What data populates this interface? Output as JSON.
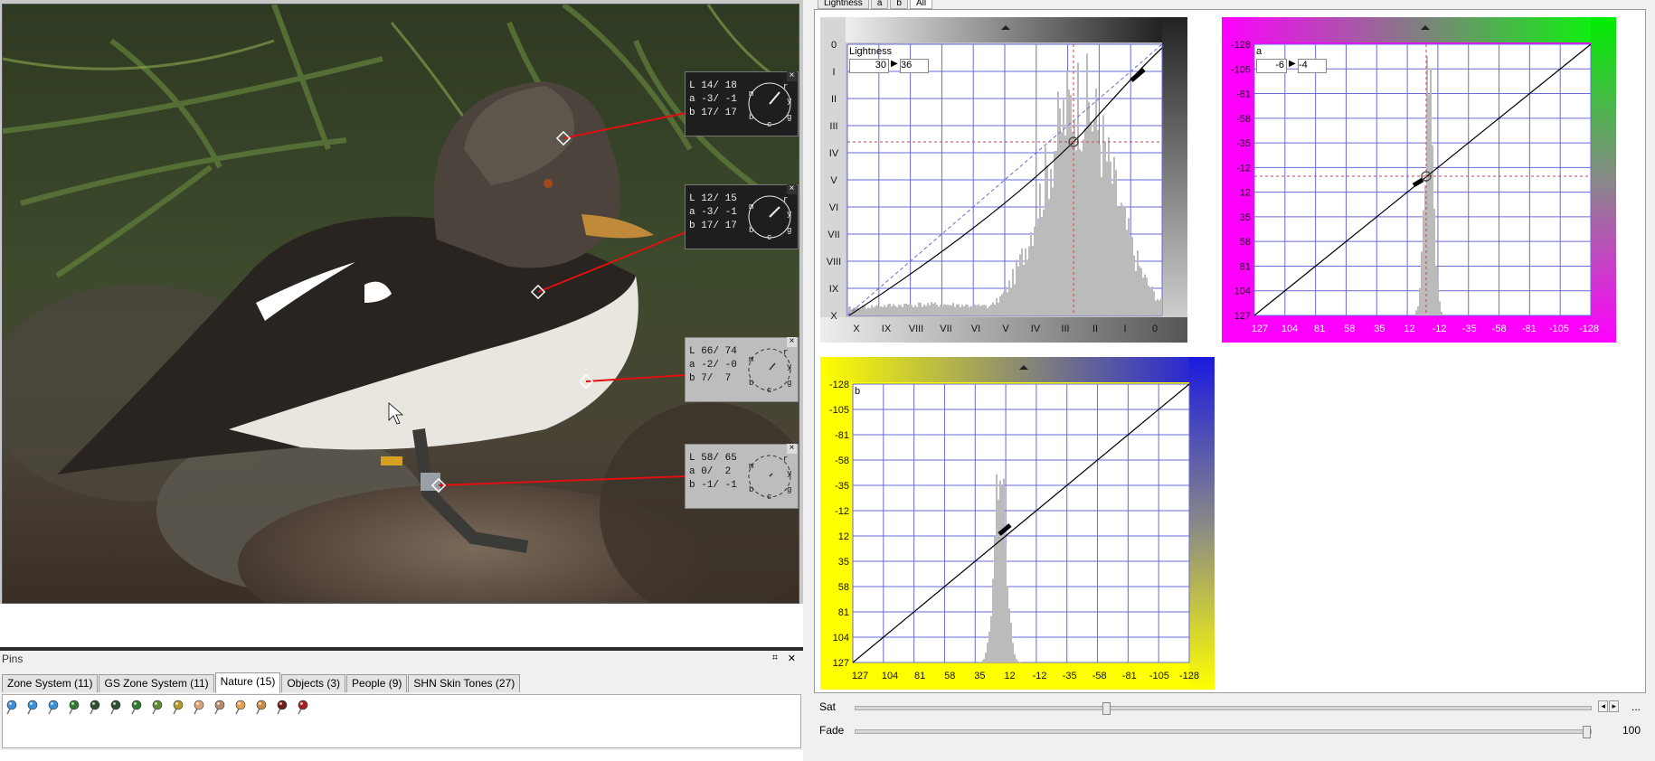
{
  "curves_tabs": [
    "Lightness",
    "a",
    "b",
    "All"
  ],
  "pins_dock": {
    "title": "Pins",
    "pin_button": "⌗",
    "close_button": "✕",
    "tabs": [
      {
        "label": "Zone System (11)",
        "active": false
      },
      {
        "label": "GS Zone System (11)",
        "active": false
      },
      {
        "label": "Nature (15)",
        "active": true
      },
      {
        "label": "Objects (3)",
        "active": false
      },
      {
        "label": "People (9)",
        "active": false
      },
      {
        "label": "SHN Skin Tones (27)",
        "active": false
      }
    ],
    "pin_colors": [
      "#3b8fd6",
      "#3b8fd6",
      "#3b8fd6",
      "#2f7a2f",
      "#2d4f2d",
      "#2d4f2d",
      "#2f7a2f",
      "#5c8b33",
      "#b39a2a",
      "#d8a27a",
      "#b58a6a",
      "#e0a050",
      "#c88a40",
      "#6b1f1f",
      "#a81f1f"
    ]
  },
  "pin_readouts": [
    {
      "L": "14/ 18",
      "a": "-3/ -1",
      "b": "17/ 17",
      "theme": "dark"
    },
    {
      "L": "12/ 15",
      "a": "-3/ -1",
      "b": "17/ 17",
      "theme": "dark"
    },
    {
      "L": "66/ 74",
      "a": "-2/ -0",
      "b": "7/  7",
      "theme": "light"
    },
    {
      "L": "58/ 65",
      "a": "0/  2",
      "b": "-1/ -1",
      "theme": "light"
    }
  ],
  "dial_letters": {
    "m": "m",
    "r": "r",
    "y": "y",
    "g": "g",
    "c": "c",
    "b": "b"
  },
  "curves": {
    "lightness": {
      "name": "Lightness",
      "in_value": "30",
      "out_value": "36",
      "y_ticks": [
        "0",
        "I",
        "II",
        "III",
        "IV",
        "V",
        "VI",
        "VII",
        "VIII",
        "IX",
        "X"
      ],
      "x_ticks": [
        "X",
        "IX",
        "VIII",
        "VII",
        "VI",
        "V",
        "IV",
        "III",
        "II",
        "I",
        "0"
      ]
    },
    "a": {
      "name": "a",
      "in_value": "-6",
      "out_value": "-4",
      "y_ticks": [
        "-128",
        "-105",
        "-81",
        "-58",
        "-35",
        "-12",
        "12",
        "35",
        "58",
        "81",
        "104",
        "127"
      ],
      "x_ticks": [
        "127",
        "104",
        "81",
        "58",
        "35",
        "12",
        "-12",
        "-35",
        "-58",
        "-81",
        "-105",
        "-128"
      ]
    },
    "b": {
      "name": "b",
      "y_ticks": [
        "-128",
        "-105",
        "-81",
        "-58",
        "-35",
        "-12",
        "12",
        "35",
        "58",
        "81",
        "104",
        "127"
      ],
      "x_ticks": [
        "127",
        "104",
        "81",
        "58",
        "35",
        "12",
        "-12",
        "-35",
        "-58",
        "-81",
        "-105",
        "-128"
      ]
    }
  },
  "sliders": {
    "sat": {
      "label": "Sat",
      "value": "...",
      "fraction": 0.34
    },
    "fade": {
      "label": "Fade",
      "value": "100",
      "fraction": 1.0
    }
  }
}
